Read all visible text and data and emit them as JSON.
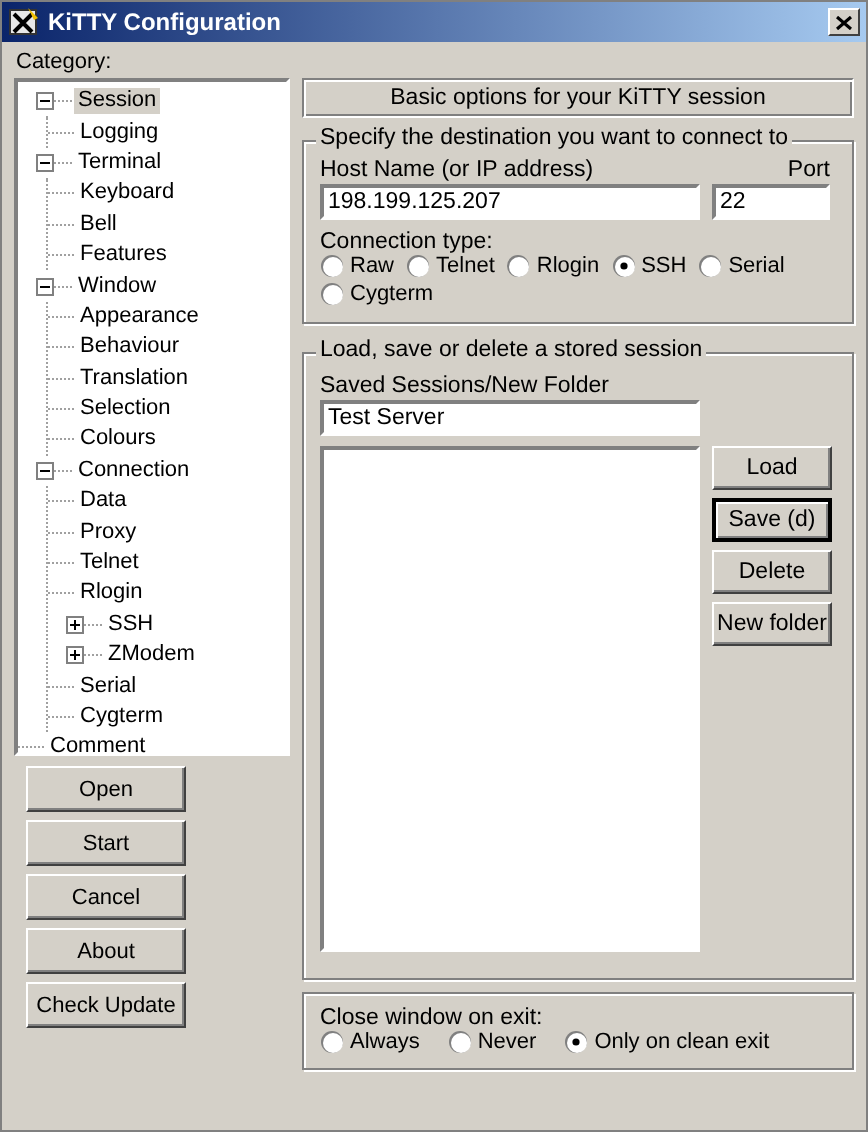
{
  "window": {
    "title": "KiTTY Configuration"
  },
  "category_label": "Category:",
  "tree": [
    {
      "label": "Session",
      "selected": true,
      "expanded": true,
      "children": [
        {
          "label": "Logging",
          "selected": false
        }
      ]
    },
    {
      "label": "Terminal",
      "selected": false,
      "expanded": true,
      "children": [
        {
          "label": "Keyboard",
          "selected": false
        },
        {
          "label": "Bell",
          "selected": false
        },
        {
          "label": "Features",
          "selected": false
        }
      ]
    },
    {
      "label": "Window",
      "selected": false,
      "expanded": true,
      "children": [
        {
          "label": "Appearance",
          "selected": false
        },
        {
          "label": "Behaviour",
          "selected": false
        },
        {
          "label": "Translation",
          "selected": false
        },
        {
          "label": "Selection",
          "selected": false
        },
        {
          "label": "Colours",
          "selected": false
        }
      ]
    },
    {
      "label": "Connection",
      "selected": false,
      "expanded": true,
      "children": [
        {
          "label": "Data",
          "selected": false
        },
        {
          "label": "Proxy",
          "selected": false
        },
        {
          "label": "Telnet",
          "selected": false
        },
        {
          "label": "Rlogin",
          "selected": false
        },
        {
          "label": "SSH",
          "selected": false,
          "expanded": false
        },
        {
          "label": "ZModem",
          "selected": false,
          "expanded": false
        },
        {
          "label": "Serial",
          "selected": false
        },
        {
          "label": "Cygterm",
          "selected": false
        }
      ]
    },
    {
      "label": "Comment",
      "selected": false
    }
  ],
  "left_buttons": [
    "Open",
    "Start",
    "Cancel",
    "About",
    "Check Update"
  ],
  "header": "Basic options for your KiTTY session",
  "destination": {
    "legend": "Specify the destination you want to connect to",
    "host_label": "Host Name (or IP address)",
    "host_value": "198.199.125.207",
    "port_label": "Port",
    "port_value": "22",
    "connection_type": {
      "label": "Connection type:",
      "options": [
        {
          "label": "Raw",
          "selected": false
        },
        {
          "label": "Telnet",
          "selected": false
        },
        {
          "label": "Rlogin",
          "selected": false
        },
        {
          "label": "SSH",
          "selected": true
        },
        {
          "label": "Serial",
          "selected": false
        },
        {
          "label": "Cygterm",
          "selected": false
        }
      ]
    }
  },
  "sessions": {
    "legend": "Load, save or delete a stored session",
    "label": "Saved Sessions/New Folder",
    "value": "Test Server",
    "buttons": [
      {
        "label": "Load",
        "default": false
      },
      {
        "label": "Save (d)",
        "default": true
      },
      {
        "label": "Delete",
        "default": false
      },
      {
        "label": "New folder",
        "default": false
      }
    ]
  },
  "close_on_exit": {
    "label": "Close window on exit:",
    "options": [
      {
        "label": "Always",
        "selected": false
      },
      {
        "label": "Never",
        "selected": false
      },
      {
        "label": "Only on clean exit",
        "selected": true
      }
    ]
  }
}
